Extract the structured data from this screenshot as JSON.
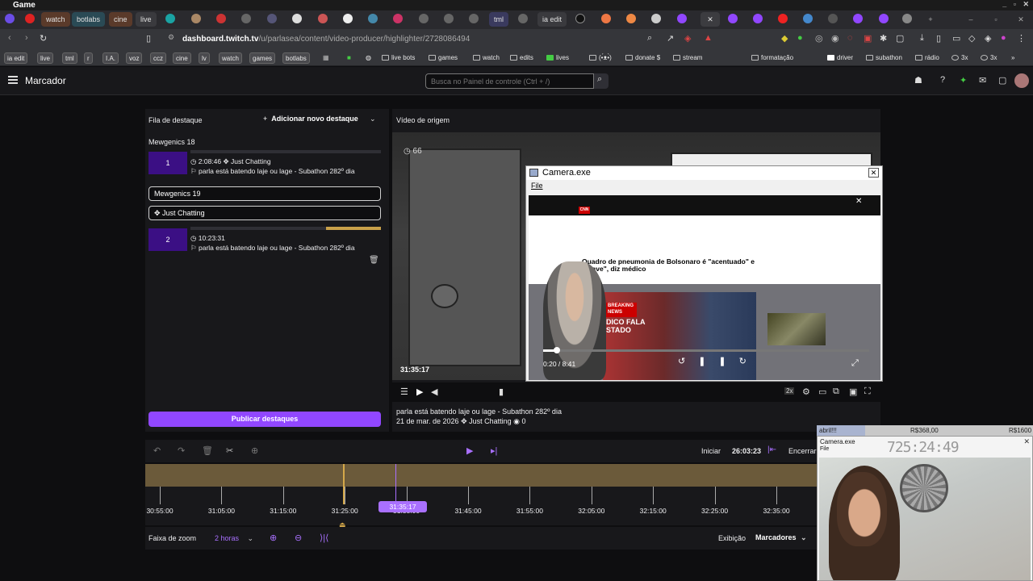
{
  "os": {
    "title": "Game"
  },
  "tabs": [
    {
      "label": "watch",
      "color": "#5a3a2a"
    },
    {
      "label": "botlabs",
      "color": "#2a4a55"
    },
    {
      "label": "cine",
      "color": "#5a3a2a"
    },
    {
      "label": "live",
      "color": "#3a3a3e"
    },
    {
      "label": "tml",
      "color": "#3a3a5e"
    },
    {
      "label": "ia edit",
      "color": "#3a3a3e"
    }
  ],
  "address": {
    "domain": "dashboard.twitch.tv",
    "path": "/u/parlasea/content/video-producer/highlighter/2728086494"
  },
  "bookmarks": {
    "pills": [
      "ia edit",
      "live",
      "tml",
      "r",
      "I.A.",
      "voz",
      "ccz",
      "cine",
      "lv",
      "watch",
      "games",
      "botlabs"
    ],
    "folders": [
      "live bots",
      "games",
      "watch",
      "edits",
      "lives",
      "(•́ᴥ•̀)",
      "donate $",
      "stream",
      "formatação",
      "driver",
      "subathon",
      "rádio",
      "3x"
    ]
  },
  "header": {
    "title": "Marcador",
    "search_placeholder": "Busca no Painel de controle (Ctrl + /)"
  },
  "queue": {
    "title": "Fila de destaque",
    "add_label": "Adicionar novo destaque",
    "items": [
      {
        "group": "Mewgenics 18",
        "num": "1",
        "time": "2:08:46",
        "category": "Just Chatting",
        "title": "parla está batendo laje ou lage - Subathon 282º dia"
      },
      {
        "group": "Mewgenics 19",
        "num": "2",
        "time": "10:23:31",
        "category": "Just Chatting",
        "title": "parla está batendo laje ou lage - Subathon 282º dia"
      }
    ],
    "publish_label": "Publicar destaques"
  },
  "source": {
    "title": "Vídeo de origem",
    "timestamp": "31:35:17",
    "video_title": "parla está batendo laje ou lage - Subathon 282º dia",
    "date": "21 de mar. de 2026",
    "category": "Just Chatting",
    "views": "0",
    "speed": "2x"
  },
  "camera_window": {
    "title": "Camera.exe",
    "menu": "File",
    "headline": "Quadro de pneumonia de Bolsonaro é \"acentuado\" e \"grave\", diz médico",
    "breaking": "BREAKING NEWS",
    "overlay_text": "DICO FALA\nSTADO",
    "time": "0:20 / 8:41",
    "progress": 0.04
  },
  "editor": {
    "start_label": "Iniciar",
    "start_time": "26:03:23",
    "end_label": "Encerrar",
    "ticks": [
      "30:55:00",
      "31:05:00",
      "31:15:00",
      "31:25:00",
      "31:35:00",
      "31:45:00",
      "31:55:00",
      "32:05:00",
      "32:15:00",
      "32:25:00",
      "32:35:00"
    ],
    "marker": "31:35:17",
    "zoom_label": "Faixa de zoom",
    "zoom_value": "2 horas",
    "display_label": "Exibição",
    "display_value": "Marcadores"
  },
  "stream_overlay": {
    "name": "abril!!!",
    "money1": "R$368,00",
    "money2": "R$1600",
    "cam_title": "Camera.exe",
    "cam_sub": "File",
    "clock": "725:24:49"
  },
  "colors": {
    "accent": "#9147ff",
    "queue_num": "#3b0f84",
    "timeline": "#6b5a3a"
  }
}
